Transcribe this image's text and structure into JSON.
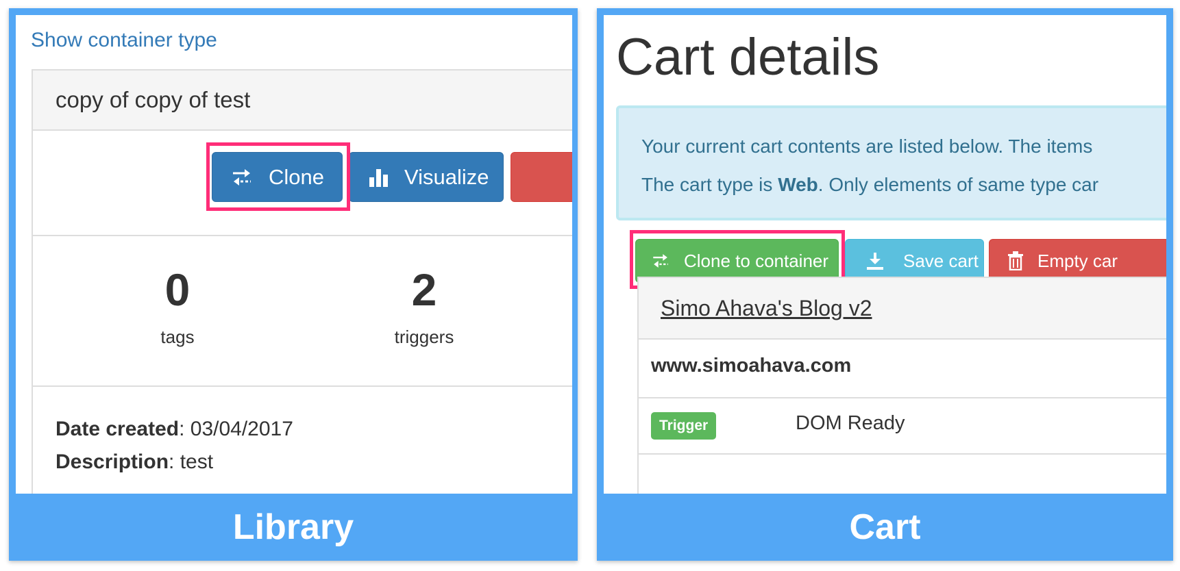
{
  "library_panel": {
    "caption": "Library",
    "show_link": "Show container type",
    "container_name": "copy of copy of test",
    "buttons": {
      "clone": "Clone",
      "visualize": "Visualize"
    },
    "stats": [
      {
        "value": "0",
        "label": "tags"
      },
      {
        "value": "2",
        "label": "triggers"
      }
    ],
    "meta": {
      "date_label": "Date created",
      "date_value": ": 03/04/2017",
      "desc_label": "Description",
      "desc_value": ": test"
    }
  },
  "cart_panel": {
    "caption": "Cart",
    "title": "Cart details",
    "alert": {
      "line1": "Your current cart contents are listed below. The items",
      "line2_prefix": "The cart type is ",
      "line2_bold": "Web",
      "line2_suffix": ". Only elements of same type car"
    },
    "buttons": {
      "clone": "Clone to container",
      "save": "Save cart",
      "empty": "Empty car"
    },
    "table": {
      "container": "Simo Ahava's Blog v2",
      "domain": "www.simoahava.com",
      "row": {
        "badge": "Trigger",
        "value": "DOM Ready"
      }
    }
  },
  "colors": {
    "panel_border": "#53a7f5",
    "highlight": "#ff2d78",
    "primary": "#337ab7",
    "success": "#5cb85c",
    "info": "#5bc0de",
    "danger": "#d9534f"
  },
  "icons": [
    "swap-arrows-icon",
    "bar-chart-icon",
    "download-icon",
    "trash-icon"
  ]
}
